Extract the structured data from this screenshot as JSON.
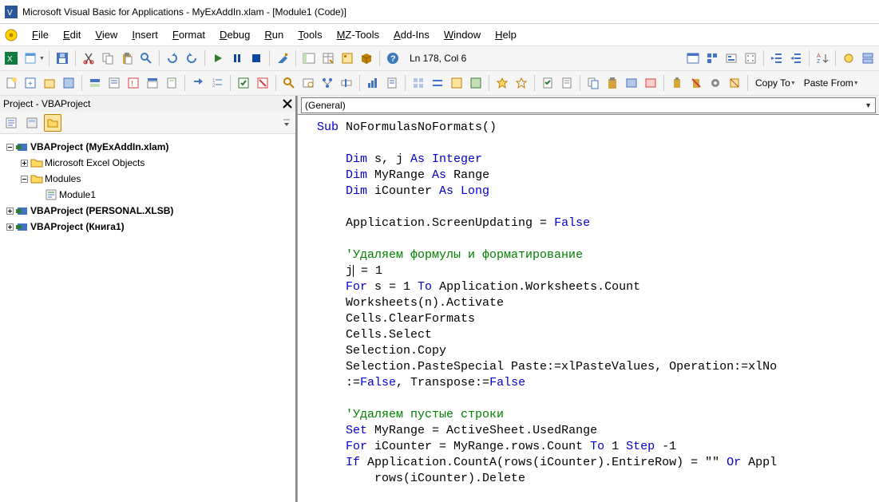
{
  "title": "Microsoft Visual Basic for Applications - MyExAddIn.xlam - [Module1 (Code)]",
  "menu": {
    "items": [
      "File",
      "Edit",
      "View",
      "Insert",
      "Format",
      "Debug",
      "Run",
      "Tools",
      "MZ-Tools",
      "Add-Ins",
      "Window",
      "Help"
    ]
  },
  "toolbar1": {
    "position": "Ln 178, Col 6"
  },
  "toolbar2": {
    "copyto": "Copy To",
    "pastefrom": "Paste From"
  },
  "project": {
    "header": "Project - VBAProject",
    "tree": {
      "root1": {
        "label": "VBAProject (MyExAddIn.xlam)",
        "children": [
          {
            "label": "Microsoft Excel Objects",
            "expanded": false
          },
          {
            "label": "Modules",
            "expanded": true,
            "children": [
              {
                "label": "Module1"
              }
            ]
          }
        ]
      },
      "root2": {
        "label": "VBAProject (PERSONAL.XLSB)"
      },
      "root3": {
        "label": "VBAProject (Книга1)"
      }
    }
  },
  "codeDropdown": {
    "left": "(General)"
  },
  "code": {
    "lines": [
      {
        "t": [
          [
            "kw",
            "Sub"
          ],
          [
            "",
            " NoFormulasNoFormats()"
          ]
        ]
      },
      {
        "t": [
          [
            "",
            ""
          ]
        ]
      },
      {
        "t": [
          [
            "",
            "    "
          ],
          [
            "kw",
            "Dim"
          ],
          [
            "",
            " s, j "
          ],
          [
            "kw",
            "As Integer"
          ]
        ]
      },
      {
        "t": [
          [
            "",
            "    "
          ],
          [
            "kw",
            "Dim"
          ],
          [
            "",
            " MyRange "
          ],
          [
            "kw",
            "As"
          ],
          [
            "",
            " Range"
          ]
        ]
      },
      {
        "t": [
          [
            "",
            "    "
          ],
          [
            "kw",
            "Dim"
          ],
          [
            "",
            " iCounter "
          ],
          [
            "kw",
            "As Long"
          ]
        ]
      },
      {
        "t": [
          [
            "",
            ""
          ]
        ]
      },
      {
        "t": [
          [
            "",
            "    Application.ScreenUpdating = "
          ],
          [
            "kw",
            "False"
          ]
        ]
      },
      {
        "t": [
          [
            "",
            ""
          ]
        ]
      },
      {
        "t": [
          [
            "",
            "    "
          ],
          [
            "cm",
            "'Удаляем формулы и форматирование"
          ]
        ]
      },
      {
        "t": [
          [
            "",
            "    j"
          ],
          [
            "caret",
            ""
          ],
          [
            "",
            " = 1"
          ]
        ]
      },
      {
        "t": [
          [
            "",
            "    "
          ],
          [
            "kw",
            "For"
          ],
          [
            "",
            " s = 1 "
          ],
          [
            "kw",
            "To"
          ],
          [
            "",
            " Application.Worksheets.Count"
          ]
        ]
      },
      {
        "t": [
          [
            "",
            "    Worksheets(n).Activate"
          ]
        ]
      },
      {
        "t": [
          [
            "",
            "    Cells.ClearFormats"
          ]
        ]
      },
      {
        "t": [
          [
            "",
            "    Cells.Select"
          ]
        ]
      },
      {
        "t": [
          [
            "",
            "    Selection.Copy"
          ]
        ]
      },
      {
        "t": [
          [
            "",
            "    Selection.PasteSpecial Paste:=xlPasteValues, Operation:=xlNo"
          ]
        ]
      },
      {
        "t": [
          [
            "",
            "    :="
          ],
          [
            "kw",
            "False"
          ],
          [
            "",
            ", Transpose:="
          ],
          [
            "kw",
            "False"
          ]
        ]
      },
      {
        "t": [
          [
            "",
            ""
          ]
        ]
      },
      {
        "t": [
          [
            "",
            "    "
          ],
          [
            "cm",
            "'Удаляем пустые строки"
          ]
        ]
      },
      {
        "t": [
          [
            "",
            "    "
          ],
          [
            "kw",
            "Set"
          ],
          [
            "",
            " MyRange = ActiveSheet.UsedRange"
          ]
        ]
      },
      {
        "t": [
          [
            "",
            "    "
          ],
          [
            "kw",
            "For"
          ],
          [
            "",
            " iCounter = MyRange.rows.Count "
          ],
          [
            "kw",
            "To"
          ],
          [
            "",
            " 1 "
          ],
          [
            "kw",
            "Step"
          ],
          [
            "",
            " -1"
          ]
        ]
      },
      {
        "t": [
          [
            "",
            "    "
          ],
          [
            "kw",
            "If"
          ],
          [
            "",
            " Application.CountA(rows(iCounter).EntireRow) = \"\" "
          ],
          [
            "kw",
            "Or"
          ],
          [
            "",
            " Appl"
          ]
        ]
      },
      {
        "t": [
          [
            "",
            "        rows(iCounter).Delete"
          ]
        ]
      }
    ]
  }
}
